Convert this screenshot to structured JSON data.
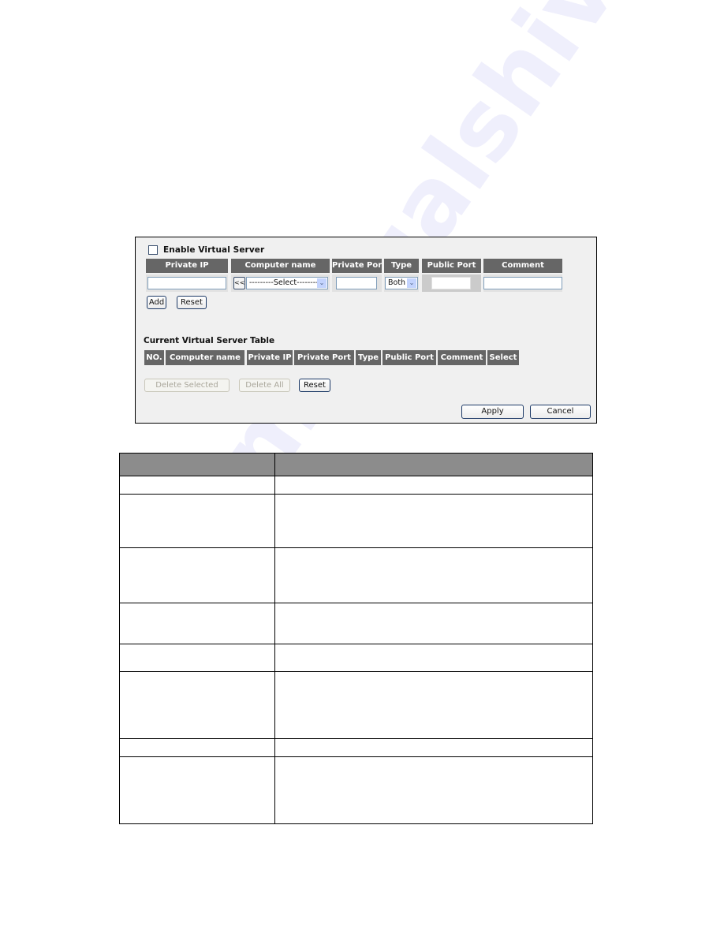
{
  "panel": {
    "enable_label": "Enable Virtual Server",
    "enable_checked": false,
    "input_headers": [
      "Private IP",
      "Computer name",
      "Private Port",
      "Type",
      "Public Port",
      "Comment"
    ],
    "inputs": {
      "private_ip": "",
      "copy_button": "<<",
      "computer_name_select": "---------Select--------",
      "private_port": "",
      "type_select": "Both",
      "public_port": "",
      "comment": ""
    },
    "add_button": "Add",
    "reset_button": "Reset",
    "table_title": "Current Virtual Server Table",
    "table_headers": [
      "NO.",
      "Computer name",
      "Private IP",
      "Private Port",
      "Type",
      "Public Port",
      "Comment",
      "Select"
    ],
    "delete_selected_button": "Delete Selected",
    "delete_all_button": "Delete All",
    "table_reset_button": "Reset",
    "apply_button": "Apply",
    "cancel_button": "Cancel"
  },
  "description_table": {
    "headers": [
      "",
      ""
    ],
    "rows": [
      [
        "",
        ""
      ],
      [
        "",
        ""
      ],
      [
        "",
        ""
      ],
      [
        "",
        ""
      ],
      [
        "",
        ""
      ],
      [
        "",
        ""
      ],
      [
        "",
        ""
      ],
      [
        "",
        ""
      ]
    ]
  },
  "watermark": "manualshive.com"
}
